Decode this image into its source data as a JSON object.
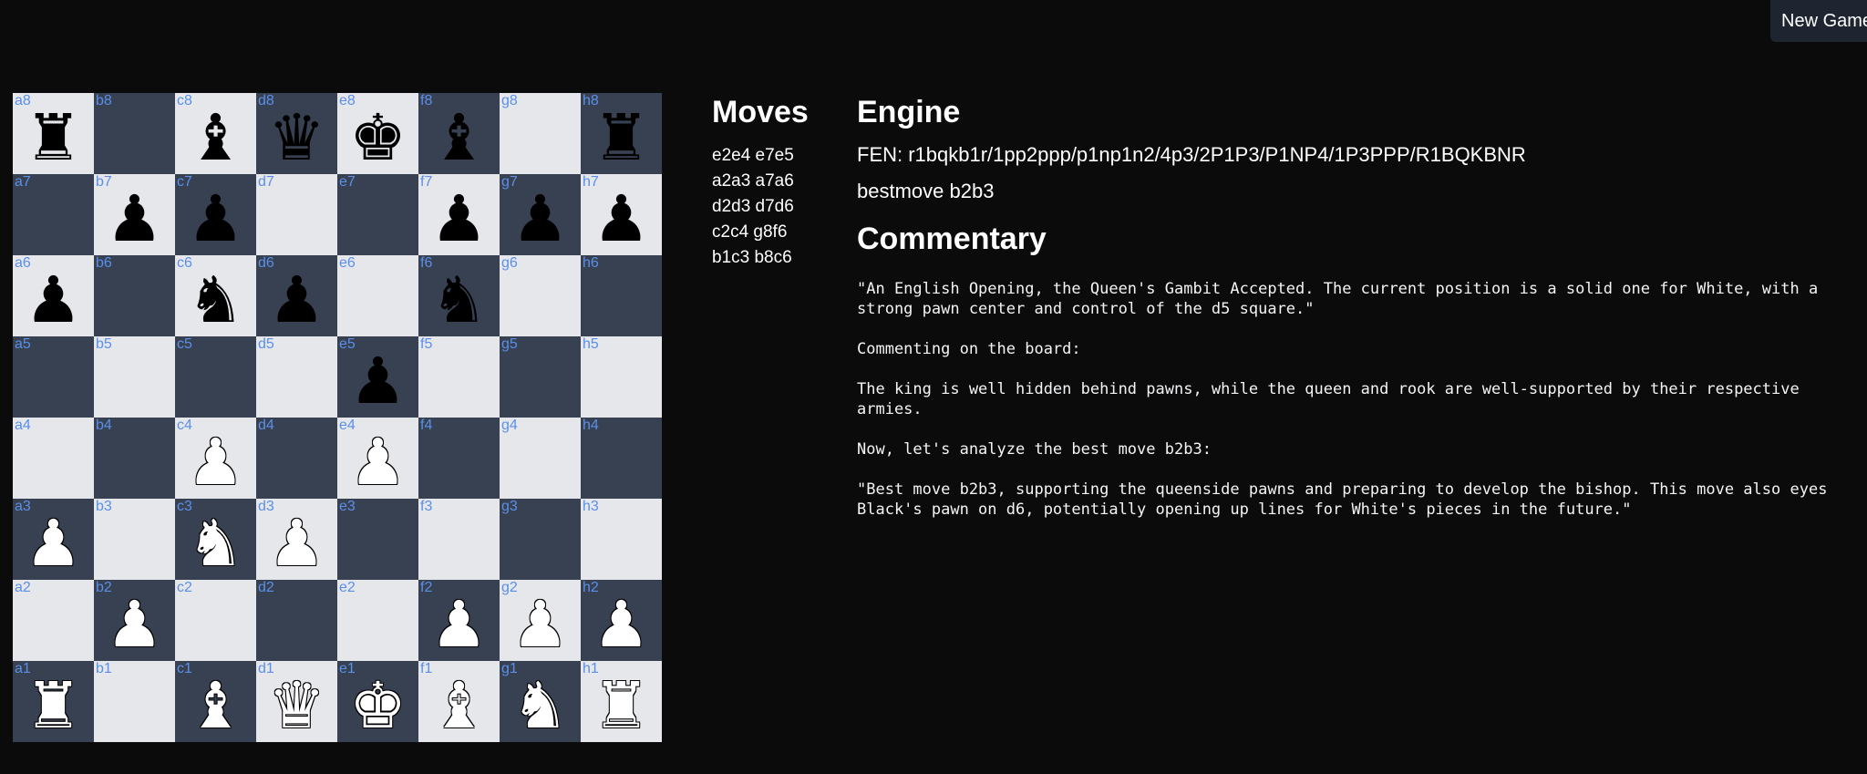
{
  "header": {
    "new_game_label": "New Game"
  },
  "board": {
    "squares": [
      {
        "coord": "a8",
        "piece": "♜",
        "color": "b",
        "shade": "light"
      },
      {
        "coord": "b8",
        "piece": "",
        "color": "",
        "shade": "dark"
      },
      {
        "coord": "c8",
        "piece": "♝",
        "color": "b",
        "shade": "light"
      },
      {
        "coord": "d8",
        "piece": "♛",
        "color": "b",
        "shade": "dark"
      },
      {
        "coord": "e8",
        "piece": "♚",
        "color": "b",
        "shade": "light"
      },
      {
        "coord": "f8",
        "piece": "♝",
        "color": "b",
        "shade": "dark"
      },
      {
        "coord": "g8",
        "piece": "",
        "color": "",
        "shade": "light"
      },
      {
        "coord": "h8",
        "piece": "♜",
        "color": "b",
        "shade": "dark"
      },
      {
        "coord": "a7",
        "piece": "",
        "color": "",
        "shade": "dark"
      },
      {
        "coord": "b7",
        "piece": "♟",
        "color": "b",
        "shade": "light"
      },
      {
        "coord": "c7",
        "piece": "♟",
        "color": "b",
        "shade": "dark"
      },
      {
        "coord": "d7",
        "piece": "",
        "color": "",
        "shade": "light"
      },
      {
        "coord": "e7",
        "piece": "",
        "color": "",
        "shade": "dark"
      },
      {
        "coord": "f7",
        "piece": "♟",
        "color": "b",
        "shade": "light"
      },
      {
        "coord": "g7",
        "piece": "♟",
        "color": "b",
        "shade": "dark"
      },
      {
        "coord": "h7",
        "piece": "♟",
        "color": "b",
        "shade": "light"
      },
      {
        "coord": "a6",
        "piece": "♟",
        "color": "b",
        "shade": "light"
      },
      {
        "coord": "b6",
        "piece": "",
        "color": "",
        "shade": "dark"
      },
      {
        "coord": "c6",
        "piece": "♞",
        "color": "b",
        "shade": "light"
      },
      {
        "coord": "d6",
        "piece": "♟",
        "color": "b",
        "shade": "dark"
      },
      {
        "coord": "e6",
        "piece": "",
        "color": "",
        "shade": "light"
      },
      {
        "coord": "f6",
        "piece": "♞",
        "color": "b",
        "shade": "dark"
      },
      {
        "coord": "g6",
        "piece": "",
        "color": "",
        "shade": "light"
      },
      {
        "coord": "h6",
        "piece": "",
        "color": "",
        "shade": "dark"
      },
      {
        "coord": "a5",
        "piece": "",
        "color": "",
        "shade": "dark"
      },
      {
        "coord": "b5",
        "piece": "",
        "color": "",
        "shade": "light"
      },
      {
        "coord": "c5",
        "piece": "",
        "color": "",
        "shade": "dark"
      },
      {
        "coord": "d5",
        "piece": "",
        "color": "",
        "shade": "light"
      },
      {
        "coord": "e5",
        "piece": "♟",
        "color": "b",
        "shade": "dark"
      },
      {
        "coord": "f5",
        "piece": "",
        "color": "",
        "shade": "light"
      },
      {
        "coord": "g5",
        "piece": "",
        "color": "",
        "shade": "dark"
      },
      {
        "coord": "h5",
        "piece": "",
        "color": "",
        "shade": "light"
      },
      {
        "coord": "a4",
        "piece": "",
        "color": "",
        "shade": "light"
      },
      {
        "coord": "b4",
        "piece": "",
        "color": "",
        "shade": "dark"
      },
      {
        "coord": "c4",
        "piece": "♟",
        "color": "w",
        "shade": "light"
      },
      {
        "coord": "d4",
        "piece": "",
        "color": "",
        "shade": "dark"
      },
      {
        "coord": "e4",
        "piece": "♟",
        "color": "w",
        "shade": "light"
      },
      {
        "coord": "f4",
        "piece": "",
        "color": "",
        "shade": "dark"
      },
      {
        "coord": "g4",
        "piece": "",
        "color": "",
        "shade": "light"
      },
      {
        "coord": "h4",
        "piece": "",
        "color": "",
        "shade": "dark"
      },
      {
        "coord": "a3",
        "piece": "♟",
        "color": "w",
        "shade": "dark"
      },
      {
        "coord": "b3",
        "piece": "",
        "color": "",
        "shade": "light"
      },
      {
        "coord": "c3",
        "piece": "♞",
        "color": "w",
        "shade": "dark"
      },
      {
        "coord": "d3",
        "piece": "♟",
        "color": "w",
        "shade": "light"
      },
      {
        "coord": "e3",
        "piece": "",
        "color": "",
        "shade": "dark"
      },
      {
        "coord": "f3",
        "piece": "",
        "color": "",
        "shade": "light"
      },
      {
        "coord": "g3",
        "piece": "",
        "color": "",
        "shade": "dark"
      },
      {
        "coord": "h3",
        "piece": "",
        "color": "",
        "shade": "light"
      },
      {
        "coord": "a2",
        "piece": "",
        "color": "",
        "shade": "light"
      },
      {
        "coord": "b2",
        "piece": "♟",
        "color": "w",
        "shade": "dark"
      },
      {
        "coord": "c2",
        "piece": "",
        "color": "",
        "shade": "light"
      },
      {
        "coord": "d2",
        "piece": "",
        "color": "",
        "shade": "dark"
      },
      {
        "coord": "e2",
        "piece": "",
        "color": "",
        "shade": "light"
      },
      {
        "coord": "f2",
        "piece": "♟",
        "color": "w",
        "shade": "dark"
      },
      {
        "coord": "g2",
        "piece": "♟",
        "color": "w",
        "shade": "light"
      },
      {
        "coord": "h2",
        "piece": "♟",
        "color": "w",
        "shade": "dark"
      },
      {
        "coord": "a1",
        "piece": "♜",
        "color": "w",
        "shade": "dark"
      },
      {
        "coord": "b1",
        "piece": "",
        "color": "",
        "shade": "light"
      },
      {
        "coord": "c1",
        "piece": "♝",
        "color": "w",
        "shade": "dark"
      },
      {
        "coord": "d1",
        "piece": "♛",
        "color": "w",
        "shade": "light"
      },
      {
        "coord": "e1",
        "piece": "♚",
        "color": "w",
        "shade": "dark"
      },
      {
        "coord": "f1",
        "piece": "♝",
        "color": "w",
        "shade": "light"
      },
      {
        "coord": "g1",
        "piece": "♞",
        "color": "w",
        "shade": "dark"
      },
      {
        "coord": "h1",
        "piece": "♜",
        "color": "w",
        "shade": "light"
      }
    ]
  },
  "moves": {
    "title": "Moves",
    "list": [
      "e2e4 e7e5",
      "a2a3 a7a6",
      "d2d3 d7d6",
      "c2c4 g8f6",
      "b1c3 b8c6"
    ]
  },
  "engine": {
    "title": "Engine",
    "fen": "FEN: r1bqkb1r/1pp2ppp/p1np1n2/4p3/2P1P3/P1NP4/1P3PPP/R1BQKBNR",
    "bestmove": "bestmove b2b3"
  },
  "commentary": {
    "title": "Commentary",
    "text": "\"An English Opening, the Queen's Gambit Accepted. The current position is a solid one for White, with a\nstrong pawn center and control of the d5 square.\"\n\nCommenting on the board:\n\nThe king is well hidden behind pawns, while the queen and rook are well-supported by their respective\narmies.\n\nNow, let's analyze the best move b2b3:\n\n\"Best move b2b3, supporting the queenside pawns and preparing to develop the bishop. This move also eyes\nBlack's pawn on d6, potentially opening up lines for White's pieces in the future.\""
  },
  "colors": {
    "background": "#0b0b0b",
    "light_square": "#e5e7eb",
    "dark_square": "#374151",
    "coord_label": "#5b8fe8",
    "button_bg": "#1f2530"
  }
}
